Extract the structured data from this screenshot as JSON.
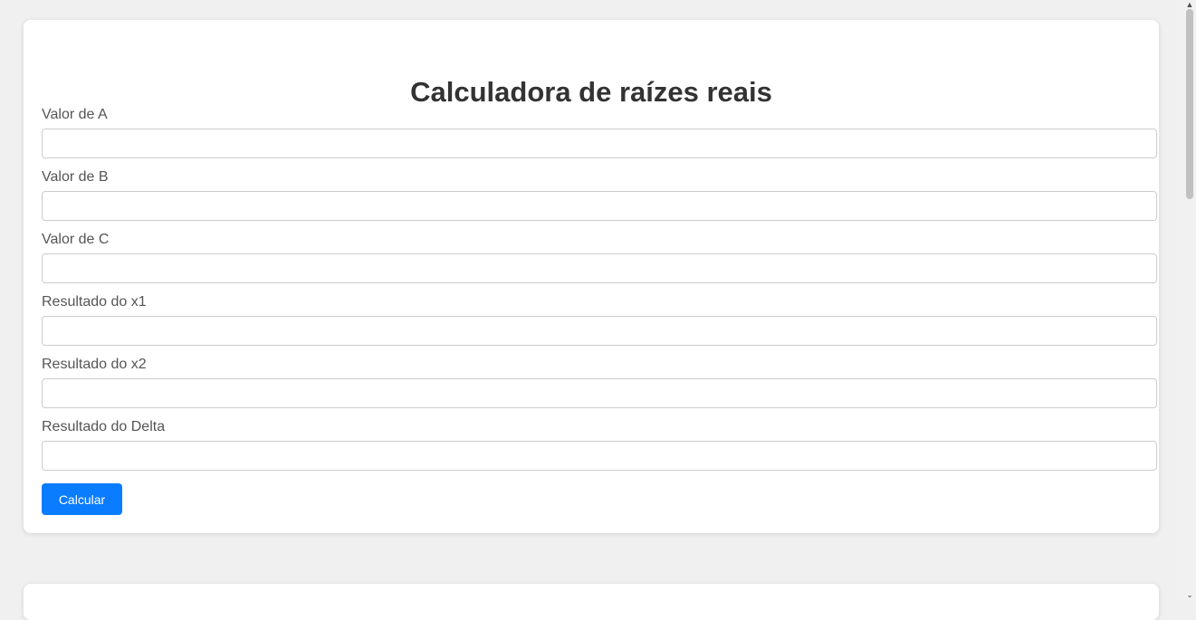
{
  "page": {
    "title": "Calculadora de raízes reais"
  },
  "form": {
    "fields": [
      {
        "label": "Valor de A",
        "value": ""
      },
      {
        "label": "Valor de B",
        "value": ""
      },
      {
        "label": "Valor de C",
        "value": ""
      },
      {
        "label": "Resultado do x1",
        "value": ""
      },
      {
        "label": "Resultado do x2",
        "value": ""
      },
      {
        "label": "Resultado do Delta",
        "value": ""
      }
    ],
    "submit_label": "Calcular"
  },
  "scrollbar": {
    "up_icon": "chevron-up-icon",
    "down_icon": "chevron-down-icon"
  },
  "colors": {
    "accent": "#0a7cff",
    "background": "#f0f0f0",
    "card": "#ffffff",
    "title": "#333333",
    "label": "#555555"
  }
}
